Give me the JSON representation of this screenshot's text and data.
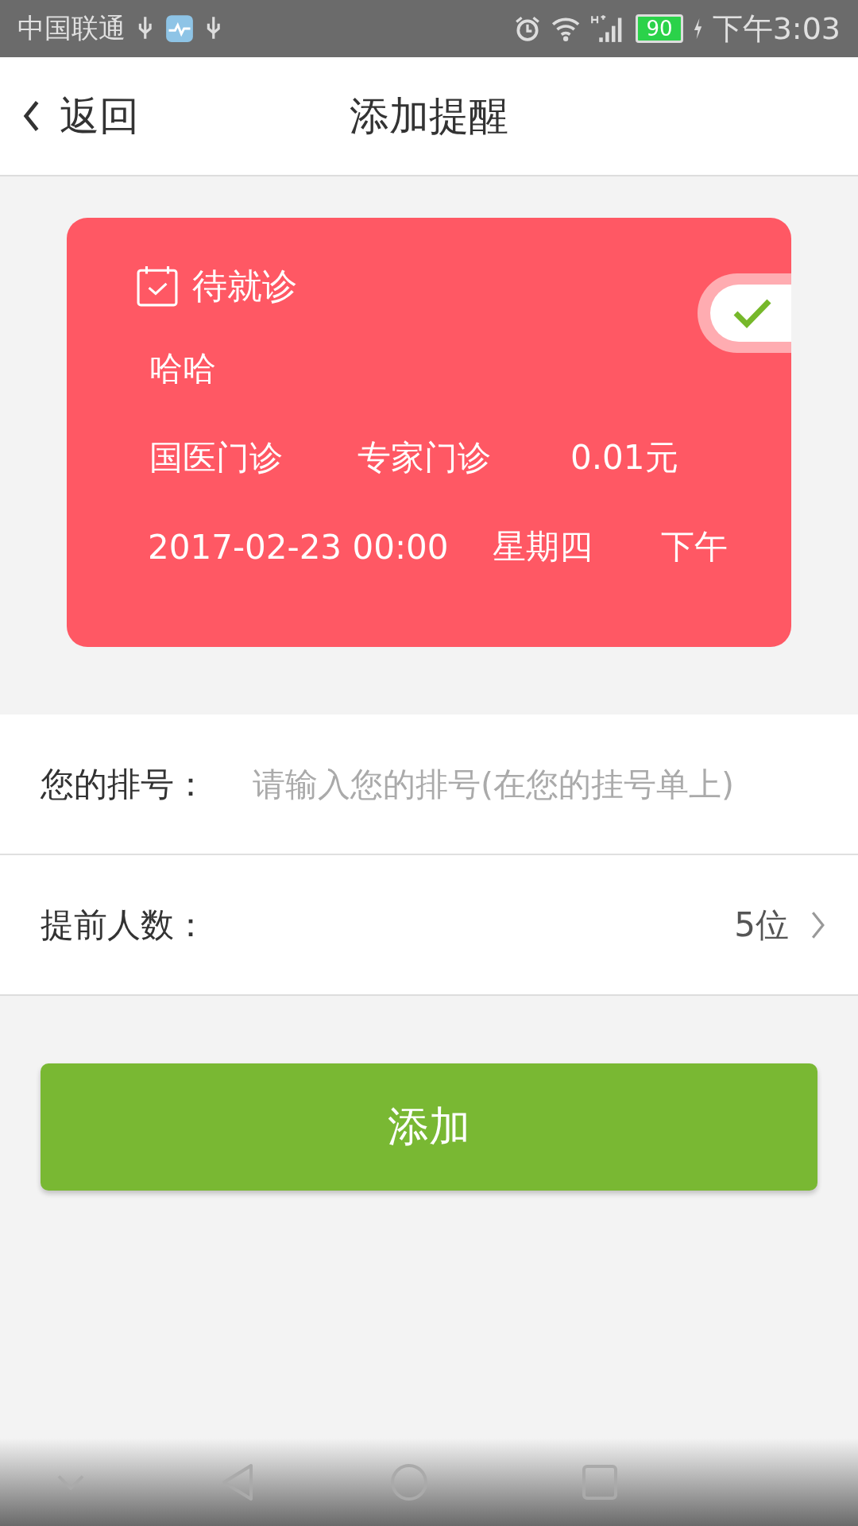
{
  "status_bar": {
    "carrier": "中国联通",
    "battery": "90",
    "time": "下午3:03"
  },
  "header": {
    "back": "返回",
    "title": "添加提醒"
  },
  "card": {
    "status": "待就诊",
    "toggle_checked": true,
    "patient": "哈哈",
    "info_row": [
      "国医门诊",
      "专家门诊",
      "0.01元"
    ],
    "time_row": [
      "2017-02-23 00:00",
      "星期四",
      "下午"
    ]
  },
  "form": [
    {
      "kind": "input",
      "label": "您的排号：",
      "placeholder": "请输入您的排号(在您的挂号单上)"
    },
    {
      "kind": "select",
      "label": "提前人数：",
      "value": "5位"
    }
  ],
  "submit": "添加"
}
